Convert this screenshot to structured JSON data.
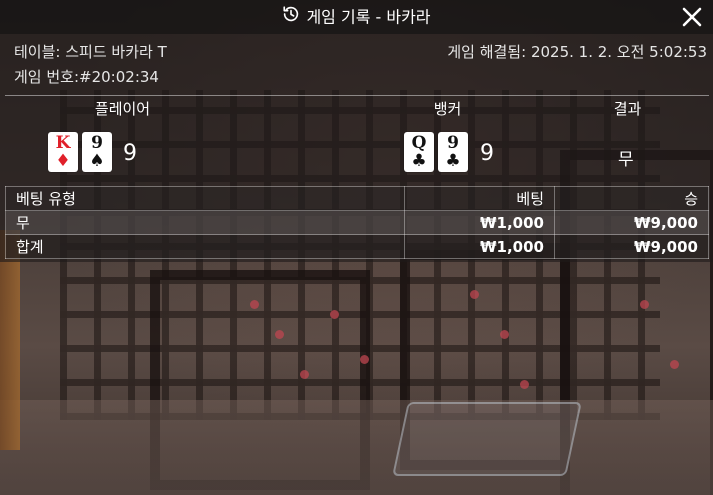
{
  "header": {
    "title": "게임 기록 - 바카라",
    "history_icon": "history-clock-icon",
    "close_icon": "close-icon"
  },
  "meta": {
    "table_label": "테이블:",
    "table_value": "스피드 바카라 T",
    "game_no_label": "게임 번호:",
    "game_no_value": "#20:02:34",
    "resolved_label": "게임 해결됨:",
    "resolved_value": "2025. 1. 2. 오전 5:02:53"
  },
  "hands": {
    "player": {
      "label": "플레이어",
      "cards": [
        {
          "rank": "K",
          "suit": "♦",
          "color": "#e0202a"
        },
        {
          "rank": "9",
          "suit": "♠",
          "color": "#111111"
        }
      ],
      "score": "9"
    },
    "banker": {
      "label": "뱅커",
      "cards": [
        {
          "rank": "Q",
          "suit": "♣",
          "color": "#111111"
        },
        {
          "rank": "9",
          "suit": "♣",
          "color": "#111111"
        }
      ],
      "score": "9"
    },
    "result": {
      "label": "결과",
      "value": "무"
    }
  },
  "bets_table": {
    "columns": [
      "베팅 유형",
      "베팅",
      "승"
    ],
    "rows": [
      {
        "type": "무",
        "bet": "₩1,000",
        "win": "₩9,000"
      },
      {
        "type": "합계",
        "bet": "₩1,000",
        "win": "₩9,000"
      }
    ]
  }
}
